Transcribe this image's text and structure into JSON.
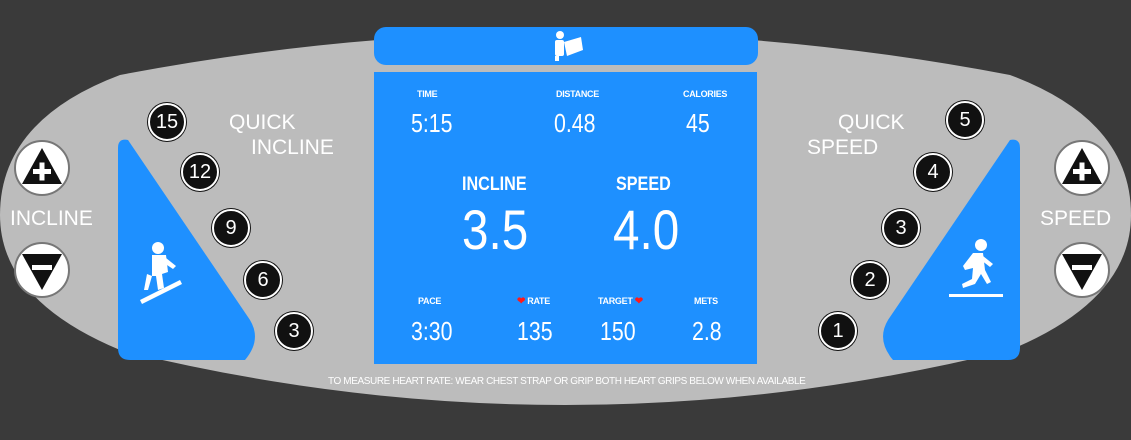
{
  "header": {
    "icon": "reading-book-icon"
  },
  "display": {
    "time": {
      "label": "TIME",
      "value": "5:15"
    },
    "distance": {
      "label": "DISTANCE",
      "value": "0.48"
    },
    "calories": {
      "label": "CALORIES",
      "value": "45"
    },
    "incline": {
      "label": "INCLINE",
      "value": "3.5"
    },
    "speed": {
      "label": "SPEED",
      "value": "4.0"
    },
    "pace": {
      "label": "PACE",
      "value": "3:30"
    },
    "rate": {
      "label": "RATE",
      "value": "135"
    },
    "target": {
      "label": "TARGET",
      "value": "150"
    },
    "mets": {
      "label": "METS",
      "value": "2.8"
    }
  },
  "quick_incline": {
    "label_line1": "QUICK",
    "label_line2": "INCLINE",
    "buttons": [
      "15",
      "12",
      "9",
      "6",
      "3"
    ]
  },
  "quick_speed": {
    "label_line1": "QUICK",
    "label_line2": "SPEED",
    "buttons": [
      "5",
      "4",
      "3",
      "2",
      "1"
    ]
  },
  "incline_control": {
    "label": "INCLINE",
    "up_icon": "plus-icon",
    "down_icon": "minus-icon"
  },
  "speed_control": {
    "label": "SPEED",
    "up_icon": "plus-icon",
    "down_icon": "minus-icon"
  },
  "footer_note": "TO MEASURE HEART RATE: WEAR CHEST STRAP OR GRIP BOTH HEART GRIPS BELOW WHEN AVAILABLE",
  "colors": {
    "screen": "#1e90ff",
    "panel": "#bcbcbc",
    "background": "#3a3a3a",
    "heart": "#ff1a1a"
  }
}
